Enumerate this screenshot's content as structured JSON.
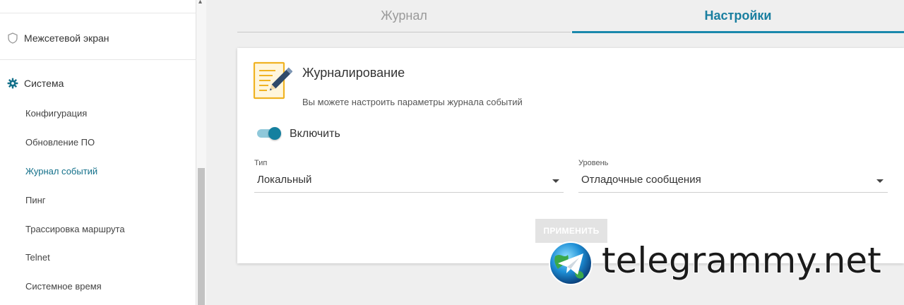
{
  "sidebar": {
    "firewall_label": "Межсетевой экран",
    "system_label": "Система",
    "items": [
      {
        "label": "Конфигурация"
      },
      {
        "label": "Обновление ПО"
      },
      {
        "label": "Журнал событий",
        "active": true
      },
      {
        "label": "Пинг"
      },
      {
        "label": "Трассировка маршрута"
      },
      {
        "label": "Telnet"
      },
      {
        "label": "Системное время"
      }
    ]
  },
  "tabs": {
    "journal": "Журнал",
    "settings": "Настройки",
    "active": "settings"
  },
  "card": {
    "icon": "edit-document-icon",
    "title": "Журналирование",
    "description": "Вы можете настроить параметры журнала событий",
    "enable_label": "Включить",
    "enabled": true,
    "type_label": "Тип",
    "type_value": "Локальный",
    "level_label": "Уровень",
    "level_value": "Отладочные сообщения",
    "apply_label": "ПРИМЕНИТЬ"
  },
  "watermark": {
    "text": "telegrammy.net",
    "icon": "telegram-globe-icon"
  },
  "colors": {
    "accent": "#1a88ac",
    "active_link": "#13708a",
    "toggle_knob": "#15809f",
    "toggle_track": "#8fc8da"
  }
}
